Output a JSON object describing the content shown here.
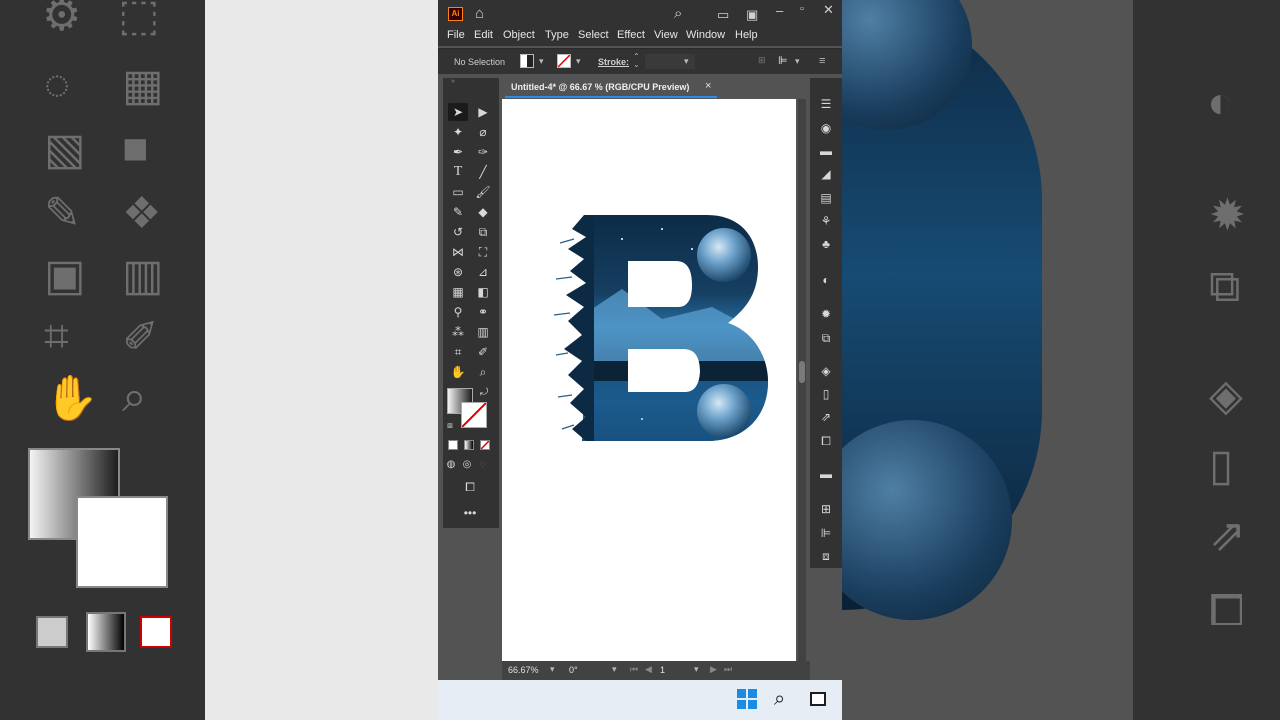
{
  "window": {
    "app_logo": "Ai",
    "icons": [
      "home-icon",
      "search-icon",
      "arrange-documents-icon",
      "workspace-icon",
      "minimize-icon",
      "maximize-icon",
      "close-icon"
    ]
  },
  "menubar": {
    "items": [
      "File",
      "Edit",
      "Object",
      "Type",
      "Select",
      "Effect",
      "View",
      "Window",
      "Help"
    ]
  },
  "controlbar": {
    "selection_label": "No Selection",
    "stroke_label": "Stroke:"
  },
  "document": {
    "tab_title": "Untitled-4* @ 66.67 % (RGB/CPU Preview)",
    "close_glyph": "×"
  },
  "statusbar": {
    "zoom": "66.67%",
    "rotation": "0°",
    "artboard_number": "1"
  },
  "colors": {
    "accent": "#2d8ceb",
    "panel_dark": "#323232",
    "workspace": "#535353",
    "letter_blue": "#1a5d8f",
    "taskbar": "#e7edf4"
  }
}
